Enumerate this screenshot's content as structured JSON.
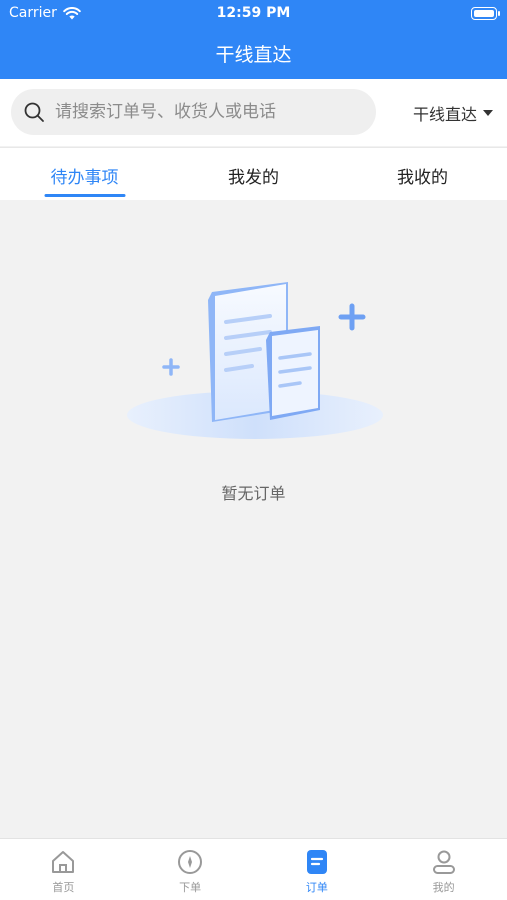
{
  "status_bar": {
    "carrier": "Carrier",
    "time": "12:59 PM"
  },
  "header": {
    "title": "干线直达"
  },
  "search": {
    "placeholder": "请搜索订单号、收货人或电话",
    "route_selector": "干线直达"
  },
  "tabs": [
    {
      "label": "待办事项",
      "active": true
    },
    {
      "label": "我发的",
      "active": false
    },
    {
      "label": "我收的",
      "active": false
    }
  ],
  "empty_state": {
    "message": "暂无订单"
  },
  "bottom_nav": [
    {
      "label": "首页",
      "icon": "home-icon",
      "active": false
    },
    {
      "label": "下单",
      "icon": "compass-icon",
      "active": false
    },
    {
      "label": "订单",
      "icon": "order-icon",
      "active": true
    },
    {
      "label": "我的",
      "icon": "profile-icon",
      "active": false
    }
  ],
  "colors": {
    "primary": "#2f86f6",
    "background": "#f2f2f2",
    "inactive": "#999999"
  }
}
